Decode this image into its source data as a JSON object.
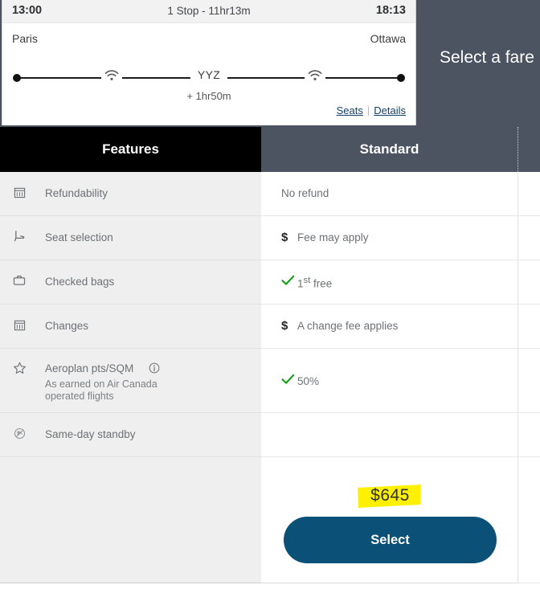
{
  "flight": {
    "departure_time": "13:00",
    "stops_summary": "1 Stop - 11hr13m",
    "arrival_time": "18:13",
    "origin_city": "Paris",
    "destination_city": "Ottawa",
    "stop_code": "YYZ",
    "layover_duration": "+ 1hr50m",
    "seats_link": "Seats",
    "link_separator": "|",
    "details_link": "Details",
    "wifi_icon_name": "wifi-icon"
  },
  "panel": {
    "select_fare_title": "Select a fare"
  },
  "table": {
    "header": {
      "features_label": "Features",
      "standard_label": "Standard"
    },
    "rows": [
      {
        "icon": "calendar-icon",
        "label": "Refundability",
        "sub": "",
        "value_icon": "",
        "value": "No refund"
      },
      {
        "icon": "seat-icon",
        "label": "Seat selection",
        "sub": "",
        "value_icon": "dollar-icon",
        "value": "Fee may apply"
      },
      {
        "icon": "suitcase-icon",
        "label": "Checked bags",
        "sub": "",
        "value_icon": "check-icon",
        "value": "1st free",
        "value_html": "1<sup>st</sup> free"
      },
      {
        "icon": "calendar-icon",
        "label": "Changes",
        "sub": "",
        "value_icon": "dollar-icon",
        "value": "A change fee applies"
      },
      {
        "icon": "star-icon",
        "label": "Aeroplan pts/SQM",
        "info_icon": "info-icon",
        "sub": "As earned on Air Canada\noperated flights",
        "value_icon": "check-icon",
        "value": "50%"
      },
      {
        "icon": "no-standby-icon",
        "label": "Same-day standby",
        "sub": "",
        "value_icon": "",
        "value": ""
      }
    ],
    "fare": {
      "price": "$645",
      "select_label": "Select",
      "highlight_color": "#fff000",
      "button_color": "#0b5077"
    }
  }
}
